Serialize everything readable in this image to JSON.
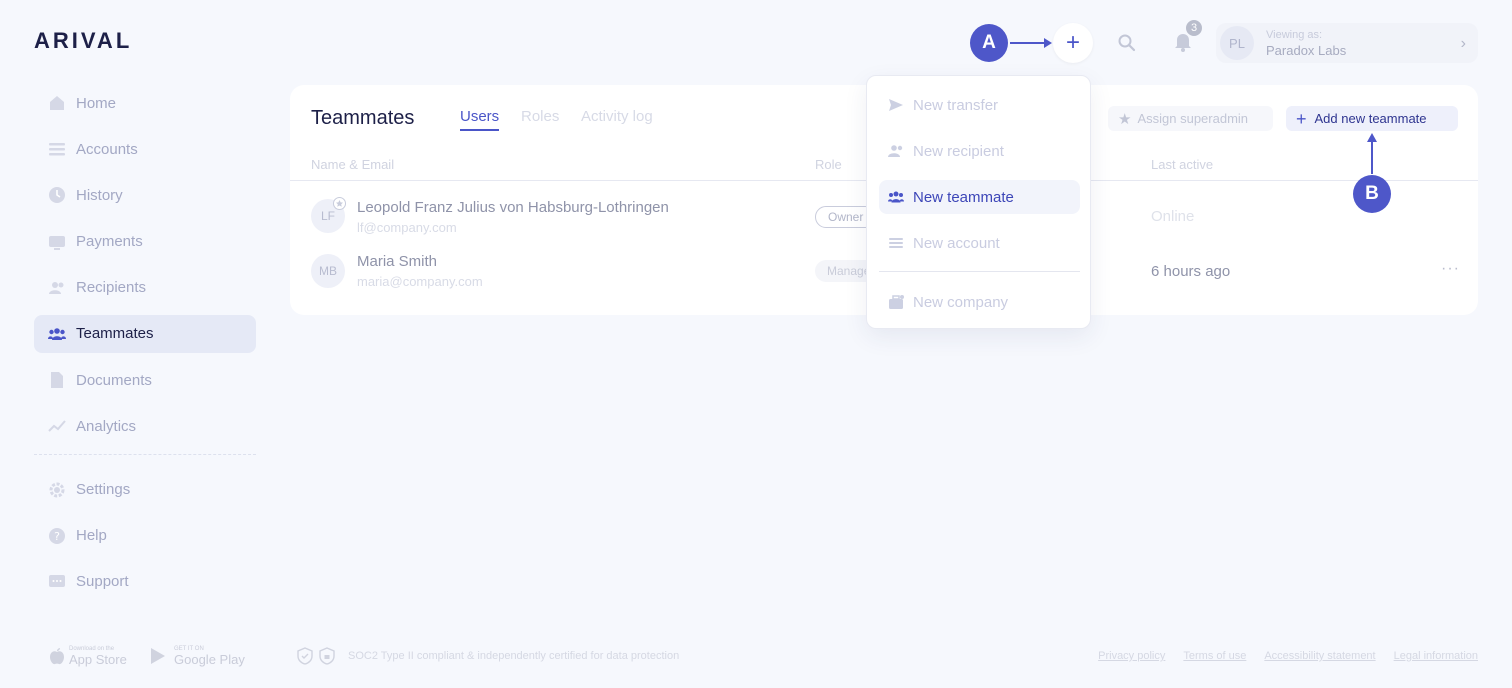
{
  "app": {
    "logo": "ARIVAL"
  },
  "sidebar": {
    "items": [
      {
        "label": "Home",
        "icon": "home-icon"
      },
      {
        "label": "Accounts",
        "icon": "accounts-icon"
      },
      {
        "label": "History",
        "icon": "history-icon"
      },
      {
        "label": "Payments",
        "icon": "payments-icon"
      },
      {
        "label": "Recipients",
        "icon": "recipients-icon"
      },
      {
        "label": "Teammates",
        "icon": "teammates-icon",
        "active": true
      },
      {
        "label": "Documents",
        "icon": "documents-icon"
      },
      {
        "label": "Analytics",
        "icon": "analytics-icon"
      }
    ],
    "secondary": [
      {
        "label": "Settings",
        "icon": "gear-icon"
      },
      {
        "label": "Help",
        "icon": "help-icon"
      },
      {
        "label": "Support",
        "icon": "chat-icon"
      }
    ]
  },
  "topbar": {
    "plus_label": "+",
    "notifications_count": "3",
    "account": {
      "initials": "PL",
      "viewing_label": "Viewing as:",
      "org_name": "Paradox Labs"
    }
  },
  "annotations": {
    "a": "A",
    "b": "B"
  },
  "card": {
    "title": "Teammates",
    "tabs": [
      {
        "label": "Users",
        "active": true
      },
      {
        "label": "Roles"
      },
      {
        "label": "Activity log"
      }
    ],
    "assign_superadmin_label": "Assign superadmin",
    "add_teammate_label": "Add new teammate",
    "columns": {
      "name_email": "Name & Email",
      "role": "Role",
      "last_active": "Last active"
    },
    "rows": [
      {
        "initials": "LF",
        "name": "Leopold Franz Julius von Habsburg-Lothringen",
        "email": "lf@company.com",
        "role": "Owner",
        "last_active": "Online"
      },
      {
        "initials": "MB",
        "name": "Maria Smith",
        "email": "maria@company.com",
        "role": "Manager",
        "last_active": "6 hours ago",
        "more": "···"
      }
    ]
  },
  "dropdown": {
    "items": [
      {
        "label": "New transfer",
        "icon": "send-icon"
      },
      {
        "label": "New recipient",
        "icon": "recipient-icon"
      },
      {
        "label": "New teammate",
        "icon": "teammates-icon",
        "active": true
      },
      {
        "label": "New account",
        "icon": "account-icon"
      },
      {
        "label": "New company",
        "icon": "company-icon"
      }
    ]
  },
  "footer": {
    "app_store_small": "Download on the",
    "app_store_big": "App Store",
    "google_small": "GET IT ON",
    "google_big": "Google Play",
    "soc": "SOC2 Type II compliant & independently certified for data protection",
    "links": [
      "Privacy policy",
      "Terms of use",
      "Accessibility statement",
      "Legal information"
    ]
  },
  "colors": {
    "accent": "#4a55c8",
    "marker": "#4e57c9",
    "background": "#f6f8fd"
  }
}
